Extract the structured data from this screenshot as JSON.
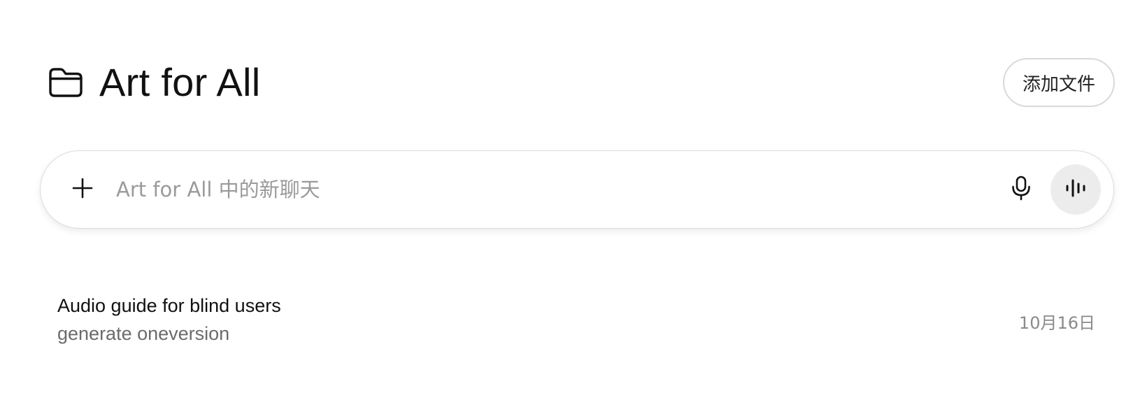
{
  "project": {
    "title": "Art for All",
    "add_files_label": "添加文件"
  },
  "composer": {
    "placeholder": "Art for All 中的新聊天",
    "value": ""
  },
  "chats": [
    {
      "title": "Audio guide for blind users",
      "snippet": "generate oneversion",
      "date": "10月16日"
    }
  ],
  "icons": {
    "folder": "folder-icon",
    "plus": "plus-icon",
    "mic": "microphone-icon",
    "voice": "voice-waveform-icon"
  }
}
